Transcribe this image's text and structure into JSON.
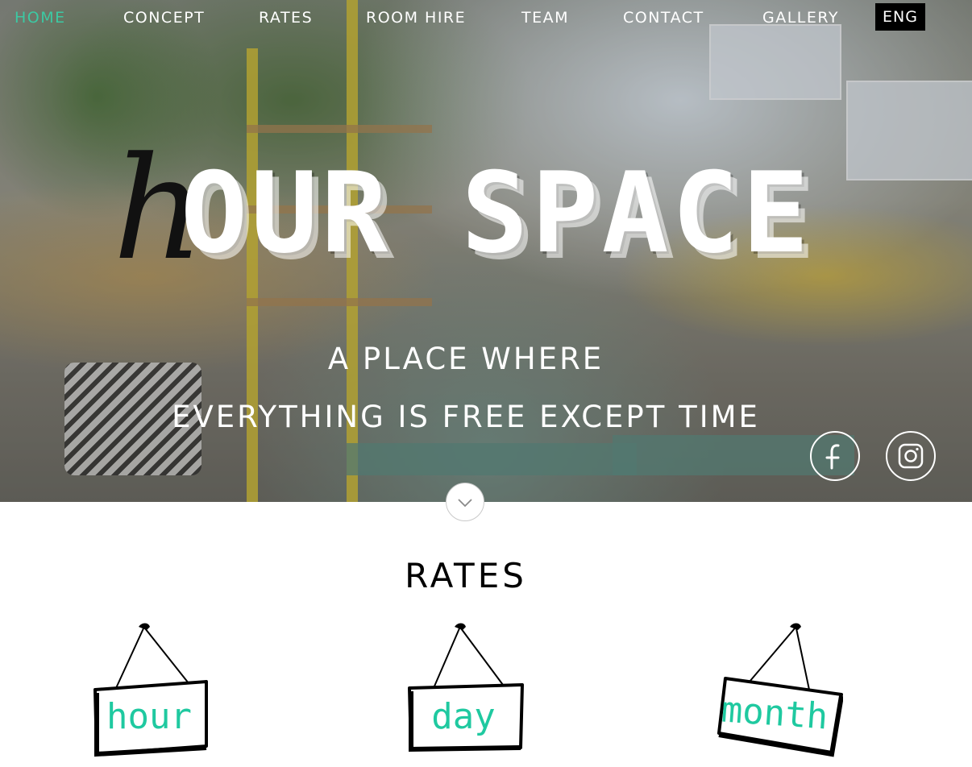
{
  "nav": {
    "items": [
      {
        "label": "HOME",
        "active": true
      },
      {
        "label": "CONCEPT"
      },
      {
        "label": "RATES"
      },
      {
        "label": "ROOM HIRE"
      },
      {
        "label": "TEAM"
      },
      {
        "label": "CONTACT"
      },
      {
        "label": "GALLERY"
      }
    ],
    "language": "ENG",
    "active_color": "#3cc9a3"
  },
  "hero": {
    "logo": {
      "script_letter": "h",
      "main_text": "OUR SPACE"
    },
    "tagline_line1": "A PLACE WHERE",
    "tagline_line2": "EVERYTHING IS FREE EXCEPT TIME",
    "social": [
      {
        "icon": "facebook-icon"
      },
      {
        "icon": "instagram-icon"
      }
    ],
    "scroll_icon": "chevron-down-icon"
  },
  "rates": {
    "title": "RATES",
    "signs": [
      {
        "label": "hour"
      },
      {
        "label": "day"
      },
      {
        "label": "month"
      }
    ],
    "accent_color": "#1fc9a0"
  }
}
